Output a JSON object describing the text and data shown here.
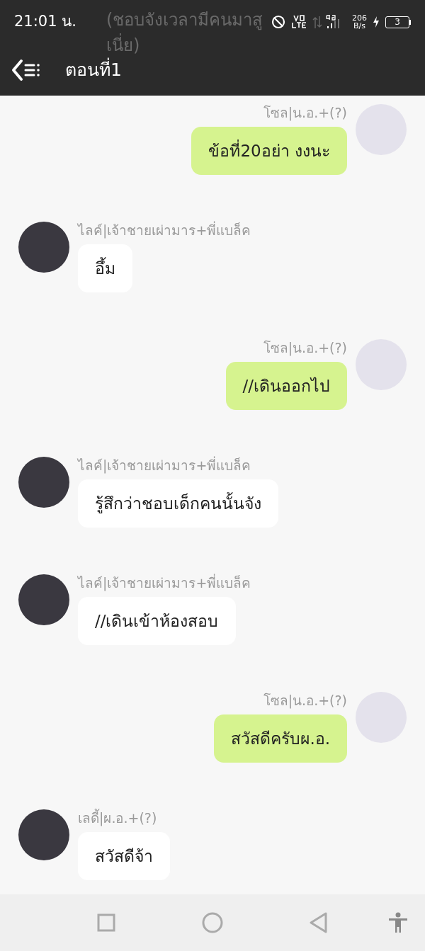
{
  "status_bar": {
    "time": "21:01 น.",
    "network_speed": "206",
    "network_speed_unit": "B/s",
    "battery": "3"
  },
  "ghost_text": [
    "(ชอบจังเวลามีคนมาสู",
    "เนี่ย)"
  ],
  "header": {
    "title": "ตอนที่1"
  },
  "messages": [
    {
      "kind": "outgoing",
      "sender": "โซล|น.อ.+(?)",
      "text": "ข้อที่20อย่า งงนะ"
    },
    {
      "kind": "incoming",
      "sender": "ไลค์|เจ้าชายเผ่ามาร+พี่แบล็ค",
      "text": "อึ้ม"
    },
    {
      "kind": "outgoing",
      "sender": "โซล|น.อ.+(?)",
      "text": "//เดินออกไป"
    },
    {
      "kind": "incoming",
      "sender": "ไลค์|เจ้าชายเผ่ามาร+พี่แบล็ค",
      "text": "รู้สึกว่าชอบเด็กคนนั้นจัง"
    },
    {
      "kind": "incoming",
      "sender": "ไลค์|เจ้าชายเผ่ามาร+พี่แบล็ค",
      "text": "//เดินเข้าห้องสอบ"
    },
    {
      "kind": "outgoing",
      "sender": "โซล|น.อ.+(?)",
      "text": "สวัสดีครับผ.อ."
    },
    {
      "kind": "incoming",
      "sender": "เลดี้|ผ.อ.+(?)",
      "text": "สวัสดีจ้า"
    }
  ]
}
